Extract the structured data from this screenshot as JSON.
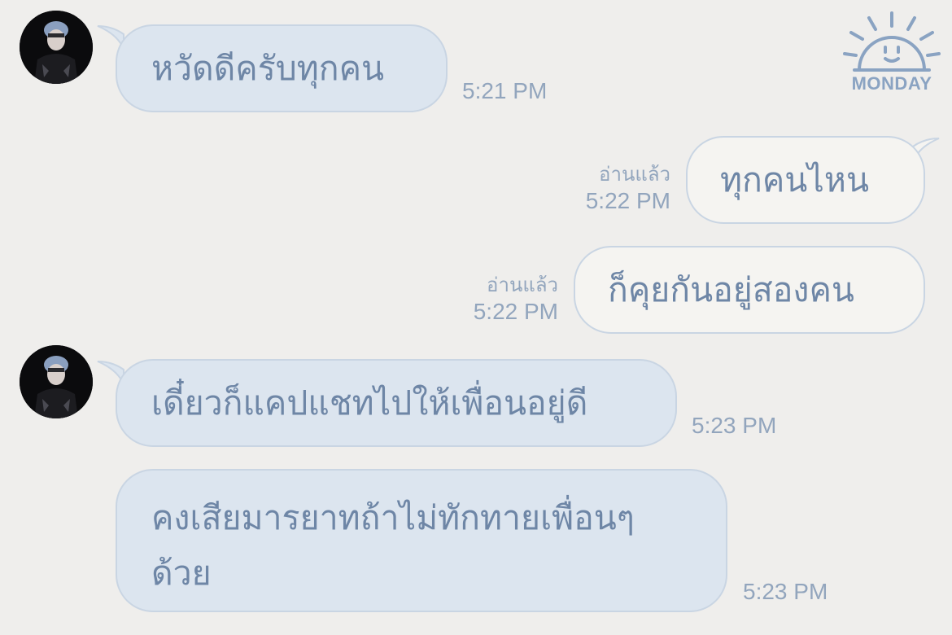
{
  "sticker": {
    "label": "MONDAY",
    "icon": "sun-sticker-icon"
  },
  "messages": [
    {
      "direction": "in",
      "text": "หวัดดีครับทุกคน",
      "time": "5:21 PM"
    },
    {
      "direction": "out",
      "text": "ทุกคนไหน",
      "read": "อ่านแล้ว",
      "time": "5:22 PM"
    },
    {
      "direction": "out",
      "text": "ก็คุยกันอยู่สองคน",
      "read": "อ่านแล้ว",
      "time": "5:22 PM"
    },
    {
      "direction": "in",
      "text": "เดี๋ยวก็แคปแชทไปให้เพื่อนอยู่ดี",
      "time": "5:23 PM"
    },
    {
      "direction": "in",
      "text_line1": "คงเสียมารยาทถ้าไม่ทักทายเพื่อนๆ",
      "text_line2": "ด้วย",
      "time": "5:23 PM"
    }
  ],
  "colors": {
    "background": "#efeeec",
    "incoming_bubble": "#dce5ef",
    "outgoing_bubble": "#f5f4f1",
    "bubble_text": "#6e86a6",
    "meta_text": "#92a5bd"
  }
}
